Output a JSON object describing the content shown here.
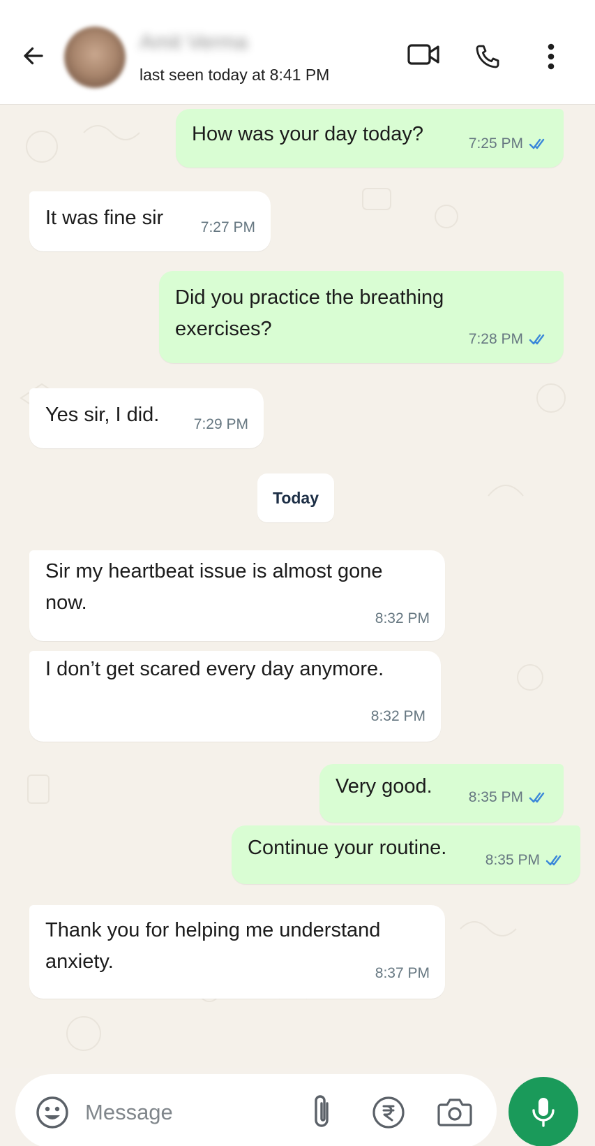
{
  "header": {
    "contact_name": "Amit Verma",
    "last_seen": "last seen today at 8:41 PM"
  },
  "messages": [
    {
      "direction": "out",
      "text_lines": [
        "How was your day today?"
      ],
      "time": "7:25 PM",
      "status": "read"
    },
    {
      "direction": "in",
      "text_lines": [
        "It was fine sir"
      ],
      "time": "7:27 PM"
    },
    {
      "direction": "out",
      "text_lines": [
        "Did you practice the breathing",
        "exercises?"
      ],
      "time": "7:28 PM",
      "status": "read"
    },
    {
      "direction": "in",
      "text_lines": [
        "Yes sir, I did."
      ],
      "time": "7:29 PM"
    },
    {
      "direction": "in",
      "text_lines": [
        "Sir my heartbeat issue is almost gone",
        "now."
      ],
      "time": "8:32 PM"
    },
    {
      "direction": "in",
      "text_lines": [
        "I don’t get scared every day anymore."
      ],
      "time": "8:32 PM"
    },
    {
      "direction": "out",
      "text_lines": [
        "Very good."
      ],
      "time": "8:35 PM",
      "status": "read"
    },
    {
      "direction": "out",
      "text_lines": [
        "Continue your routine."
      ],
      "time": "8:35 PM",
      "status": "read"
    },
    {
      "direction": "in",
      "text_lines": [
        "Thank you for helping me understand",
        "anxiety."
      ],
      "time": "8:37 PM"
    }
  ],
  "date_separator": "Today",
  "input": {
    "placeholder": "Message"
  },
  "icons": {
    "back": "arrow-left-icon",
    "video": "video-camera-icon",
    "call": "phone-icon",
    "more": "more-vertical-icon",
    "emoji": "emoji-icon",
    "attach": "paperclip-icon",
    "payment": "rupee-icon",
    "camera": "camera-icon",
    "mic": "microphone-icon"
  },
  "colors": {
    "outgoing_bubble": "#d9fdd3",
    "incoming_bubble": "#ffffff",
    "read_ticks": "#3a87d9",
    "mic_button": "#1a9a5a",
    "chat_background": "#f5f1ea"
  }
}
